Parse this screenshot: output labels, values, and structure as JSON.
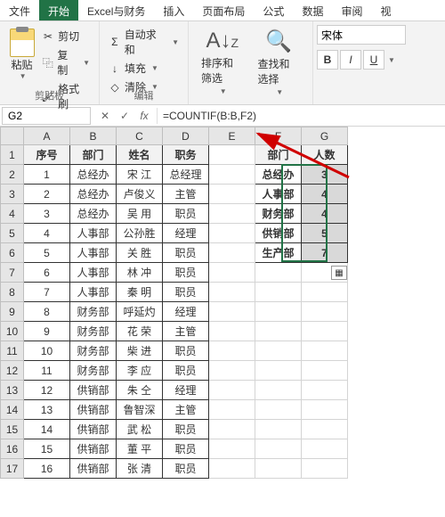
{
  "tabs": {
    "file": "文件",
    "home": "开始",
    "excelFinance": "Excel与财务",
    "insert": "插入",
    "pageLayout": "页面布局",
    "formulas": "公式",
    "data": "数据",
    "review": "审阅",
    "view": "视"
  },
  "ribbon": {
    "paste": "粘贴",
    "cut": "剪切",
    "copy": "复制",
    "formatPainter": "格式刷",
    "clipboard": "剪贴板",
    "autoSum": "自动求和",
    "fill": "填充",
    "clear": "清除",
    "editing": "编辑",
    "sortFilter": "排序和筛选",
    "findSelect": "查找和选择",
    "font": "宋体",
    "bold": "B",
    "italic": "I",
    "underline": "U"
  },
  "nameBox": "G2",
  "formula": "=COUNTIF(B:B,F2)",
  "cols": [
    "A",
    "B",
    "C",
    "D",
    "E",
    "F",
    "G"
  ],
  "rows": [
    "1",
    "2",
    "3",
    "4",
    "5",
    "6",
    "7",
    "8",
    "9",
    "10",
    "11",
    "12",
    "13",
    "14",
    "15",
    "16",
    "17"
  ],
  "headers": {
    "seq": "序号",
    "dept": "部门",
    "name": "姓名",
    "title": "职务",
    "dept2": "部门",
    "count": "人数"
  },
  "data": [
    {
      "n": "1",
      "d": "总经办",
      "nm": "宋 江",
      "t": "总经理"
    },
    {
      "n": "2",
      "d": "总经办",
      "nm": "卢俊义",
      "t": "主管"
    },
    {
      "n": "3",
      "d": "总经办",
      "nm": "吴 用",
      "t": "职员"
    },
    {
      "n": "4",
      "d": "人事部",
      "nm": "公孙胜",
      "t": "经理"
    },
    {
      "n": "5",
      "d": "人事部",
      "nm": "关 胜",
      "t": "职员"
    },
    {
      "n": "6",
      "d": "人事部",
      "nm": "林 冲",
      "t": "职员"
    },
    {
      "n": "7",
      "d": "人事部",
      "nm": "秦 明",
      "t": "职员"
    },
    {
      "n": "8",
      "d": "财务部",
      "nm": "呼延灼",
      "t": "经理"
    },
    {
      "n": "9",
      "d": "财务部",
      "nm": "花 荣",
      "t": "主管"
    },
    {
      "n": "10",
      "d": "财务部",
      "nm": "柴 进",
      "t": "职员"
    },
    {
      "n": "11",
      "d": "财务部",
      "nm": "李 应",
      "t": "职员"
    },
    {
      "n": "12",
      "d": "供销部",
      "nm": "朱 仝",
      "t": "经理"
    },
    {
      "n": "13",
      "d": "供销部",
      "nm": "鲁智深",
      "t": "主管"
    },
    {
      "n": "14",
      "d": "供销部",
      "nm": "武 松",
      "t": "职员"
    },
    {
      "n": "15",
      "d": "供销部",
      "nm": "董 平",
      "t": "职员"
    },
    {
      "n": "16",
      "d": "供销部",
      "nm": "张 清",
      "t": "职员"
    }
  ],
  "summary": [
    {
      "d": "总经办",
      "c": "3"
    },
    {
      "d": "人事部",
      "c": "4"
    },
    {
      "d": "财务部",
      "c": "4"
    },
    {
      "d": "供销部",
      "c": "5"
    },
    {
      "d": "生产部",
      "c": "7"
    }
  ]
}
